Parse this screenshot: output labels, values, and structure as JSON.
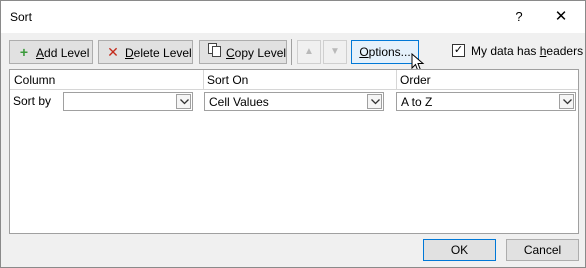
{
  "window": {
    "title": "Sort",
    "help_label": "?",
    "close_label": "✕"
  },
  "toolbar": {
    "add_level": {
      "accel": "A",
      "rest": "dd Level"
    },
    "delete_level": {
      "accel": "D",
      "rest": "elete Level"
    },
    "copy_level": {
      "accel": "C",
      "rest": "opy Level"
    },
    "move_up_label": "▲",
    "move_down_label": "▼",
    "options": {
      "accel": "O",
      "rest": "ptions..."
    },
    "headers": {
      "label_pre": "My data has ",
      "accel": "h",
      "label_post": "eaders",
      "checked": true,
      "check_glyph": "✓"
    }
  },
  "grid": {
    "columns": [
      "Column",
      "Sort On",
      "Order"
    ],
    "rows": [
      {
        "label": "Sort by",
        "column": "",
        "sort_on": "Cell Values",
        "order": "A to Z"
      }
    ]
  },
  "footer": {
    "ok_label": "OK",
    "cancel_label": "Cancel"
  },
  "colors": {
    "accent": "#0078d7",
    "add_icon": "#3a9a3a",
    "delete_icon": "#c42b1c"
  },
  "icons": {
    "add": "plus-icon",
    "delete": "x-icon",
    "copy": "copy-icon",
    "dropdown": "chevron-down-icon"
  }
}
